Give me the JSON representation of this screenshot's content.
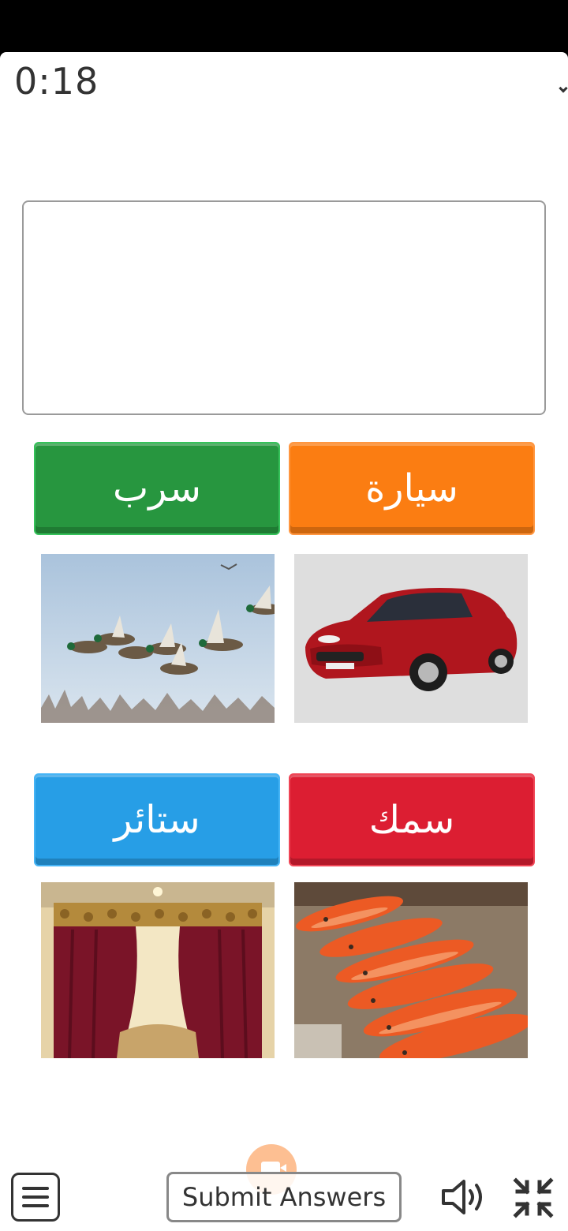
{
  "timer": "0:18",
  "answer_box": {
    "value": ""
  },
  "words": [
    {
      "label": "سرب",
      "color": "#27963f"
    },
    {
      "label": "سيارة",
      "color": "#fb7d12"
    },
    {
      "label": "ستائر",
      "color": "#279ee6"
    },
    {
      "label": "سمك",
      "color": "#dc1e32"
    }
  ],
  "images": [
    "flying-ducks",
    "red-car",
    "curtains",
    "red-fish"
  ],
  "footer": {
    "submit_label": "Submit Answers",
    "icons": [
      "menu-icon",
      "camera-icon",
      "speaker-icon",
      "shrink-icon"
    ]
  }
}
